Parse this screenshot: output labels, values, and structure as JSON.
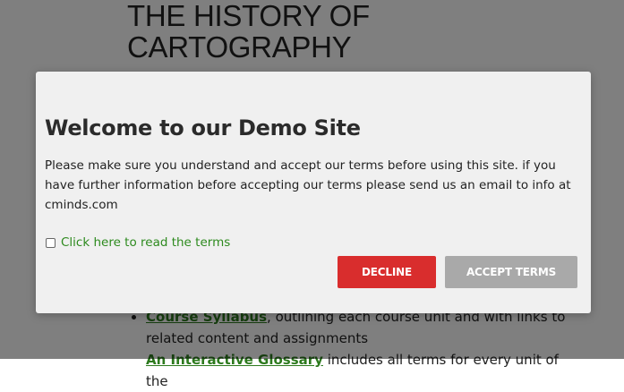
{
  "page": {
    "title": "THE HISTORY OF CARTOGRAPHY",
    "list_items": [
      {
        "link": "Course Syllabus",
        "text": ", outlining each course unit and with links to related content and assignments"
      },
      {
        "link": "An Interactive Glossary",
        "text": " includes all terms for every unit of the"
      }
    ]
  },
  "modal": {
    "title": "Welcome to our Demo Site",
    "body": "Please make sure you understand and accept our terms before using this site. if you have further information before accepting our terms please send us an email to info at cminds.com",
    "terms_checkbox_checked": false,
    "terms_link": "Click here to read the terms",
    "decline_label": "DECLINE",
    "accept_label": "ACCEPT TERMS"
  },
  "colors": {
    "overlay": "#7f7f7f",
    "modal_background": "#f0f0f0",
    "decline_button": "#d92d2d",
    "accept_button": "#a9a9a9",
    "link_green": "#2d8a1e"
  }
}
